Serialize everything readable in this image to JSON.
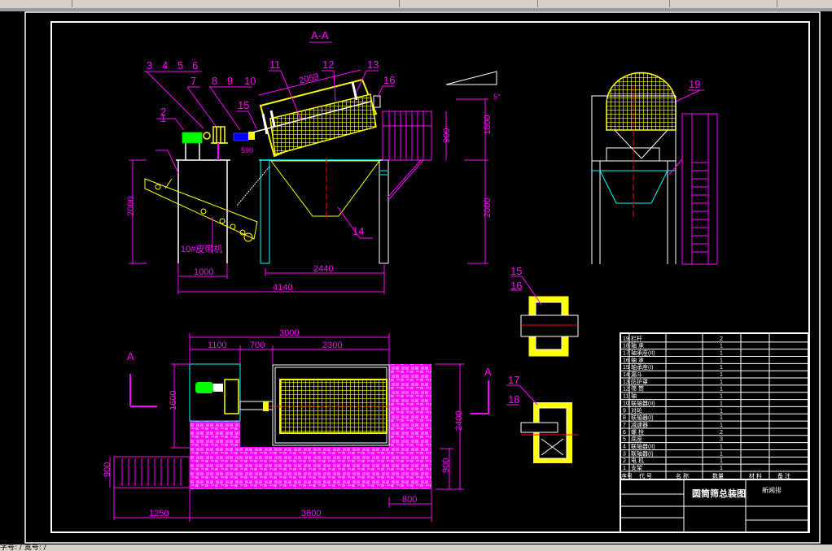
{
  "app": {
    "status_text": "字号: / 宽号: /"
  },
  "colors": {
    "background": "#000000",
    "dimension": "#ff00ff",
    "screen_mesh": "#ffff00",
    "frame": "#00ffff",
    "motor": "#00ff00",
    "coupling": "#0000ff",
    "centerline": "#ff0000"
  },
  "drawing": {
    "section_title": "A-A",
    "section_mark": "A",
    "front_view": {
      "part_numbers": [
        "1",
        "2",
        "3",
        "4",
        "5",
        "6",
        "7",
        "8",
        "9",
        "10",
        "11",
        "12",
        "13",
        "14",
        "15",
        "16"
      ],
      "dims": {
        "drum_length": "2059",
        "left_height": "2000",
        "stand_width": "1000",
        "leg_span": "2440",
        "overall_length": "4140",
        "upper_height": "900",
        "top_height": "1800",
        "lower_height": "2000",
        "coupling_dim": "590"
      },
      "conveyor_label": "10#皮带机",
      "slope_label": "5°"
    },
    "side_view": {
      "part_number": "19"
    },
    "details": [
      {
        "numbers": [
          "15",
          "16"
        ]
      },
      {
        "numbers": [
          "17",
          "18"
        ]
      }
    ],
    "plan_view": {
      "dims": {
        "overall": "3000",
        "seg1": "1100",
        "seg2": "700",
        "seg3": "2300",
        "depth": "1600",
        "right_height": "2400",
        "right_lower": "900",
        "stair_height": "900",
        "stair_length": "1250",
        "base_length": "3600",
        "right_width": "800"
      }
    }
  },
  "title_block": {
    "drawing_title": "圆筒筛总装图",
    "org": "新闻排",
    "columns": [
      "序号",
      "代 号",
      "名 称",
      "数量",
      "材 料",
      "备 注"
    ],
    "rows": [
      {
        "no": "19",
        "name": "栏杆",
        "qty": "2"
      },
      {
        "no": "18",
        "name": "轴 承",
        "qty": "1"
      },
      {
        "no": "17",
        "name": "轴承座(II)",
        "qty": "1"
      },
      {
        "no": "16",
        "name": "轴 承",
        "qty": "1"
      },
      {
        "no": "15",
        "name": "轴承座(I)",
        "qty": "1"
      },
      {
        "no": "14",
        "name": "漏斗",
        "qty": "1"
      },
      {
        "no": "13",
        "name": "防护罩",
        "qty": "1"
      },
      {
        "no": "12",
        "name": "筛 筒",
        "qty": "1"
      },
      {
        "no": "11",
        "name": "轴",
        "qty": "1"
      },
      {
        "no": "10",
        "name": "联轴器(II)",
        "qty": "1"
      },
      {
        "no": "9",
        "name": "对轮",
        "qty": "1"
      },
      {
        "no": "8",
        "name": "联轴器(I)",
        "qty": "1"
      },
      {
        "no": "7",
        "name": "减速器",
        "qty": "1"
      },
      {
        "no": "6",
        "name": "螺 栓",
        "qty": "2"
      },
      {
        "no": "5",
        "name": "底座",
        "qty": "3"
      },
      {
        "no": "4",
        "name": "联轴器(II)",
        "qty": "1"
      },
      {
        "no": "3",
        "name": "联轴器(I)",
        "qty": "1"
      },
      {
        "no": "2",
        "name": "电 机",
        "qty": "1"
      },
      {
        "no": "1",
        "name": "支架",
        "qty": "1"
      }
    ]
  }
}
